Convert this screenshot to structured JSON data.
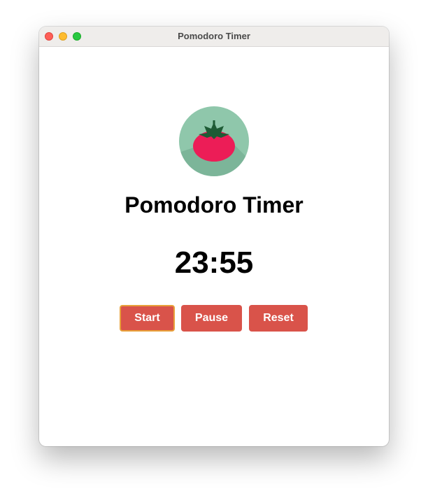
{
  "window": {
    "title": "Pomodoro Timer"
  },
  "app": {
    "logo_icon": "tomato-icon",
    "title": "Pomodoro Timer",
    "timer": "23:55"
  },
  "controls": {
    "start_label": "Start",
    "pause_label": "Pause",
    "reset_label": "Reset"
  },
  "colors": {
    "button": "#d9534a",
    "focus_ring": "#e8a13a",
    "logo_background": "#8fc7ab",
    "tomato": "#ec1d57",
    "leaves": "#1e5b35"
  }
}
